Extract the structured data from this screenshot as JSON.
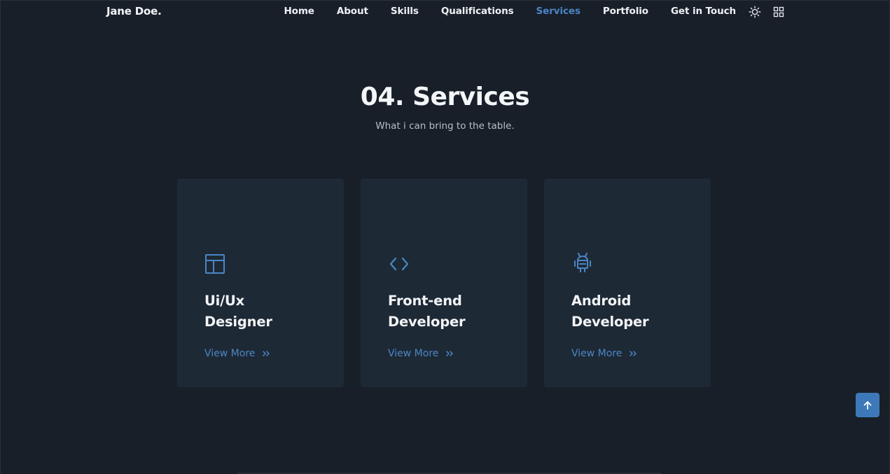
{
  "header": {
    "logo": "Jane Doe.",
    "nav": [
      {
        "label": "Home"
      },
      {
        "label": "About"
      },
      {
        "label": "Skills"
      },
      {
        "label": "Qualifications"
      },
      {
        "label": "Services"
      },
      {
        "label": "Portfolio"
      },
      {
        "label": "Get in Touch"
      }
    ],
    "active_nav": "Services",
    "theme_icon": "sun-icon",
    "apps_icon": "grid-icon"
  },
  "section": {
    "title": "04. Services",
    "subtitle": "What i can bring to the table."
  },
  "cards": [
    {
      "icon": "layout-icon",
      "title_line1": "Ui/Ux",
      "title_line2": "Designer",
      "link": "View More"
    },
    {
      "icon": "code-icon",
      "title_line1": "Front-end",
      "title_line2": "Developer",
      "link": "View More"
    },
    {
      "icon": "android-icon",
      "title_line1": "Android",
      "title_line2": "Developer",
      "link": "View More"
    }
  ],
  "scroll_top_icon": "arrow-up-icon",
  "colors": {
    "background": "#181f29",
    "card": "#1e2936",
    "accent": "#4a86c6",
    "text": "#f2f4f6",
    "muted": "#b7bec8"
  }
}
